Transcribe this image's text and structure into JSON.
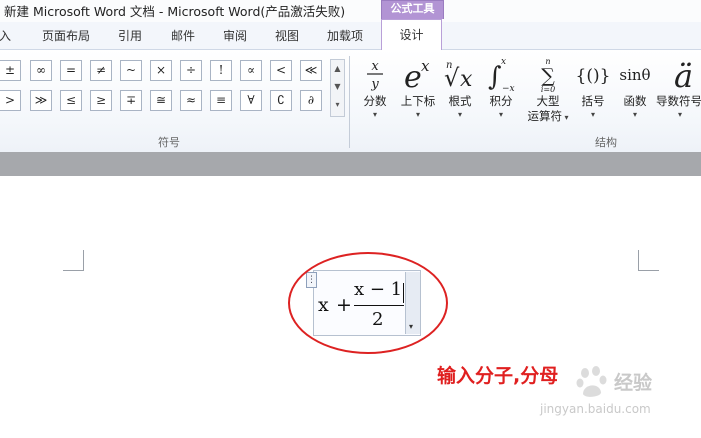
{
  "window": {
    "title": "新建 Microsoft Word 文档 - Microsoft Word(产品激活失败)",
    "context_group": "公式工具"
  },
  "tabs": [
    "入",
    "页面布局",
    "引用",
    "邮件",
    "审阅",
    "视图",
    "加载项"
  ],
  "active_tab": "设计",
  "ribbon": {
    "symbols_row1": [
      "±",
      "∞",
      "=",
      "≠",
      "~",
      "×",
      "÷",
      "!",
      "∝",
      "<",
      "≪"
    ],
    "symbols_row2": [
      ">",
      "≫",
      "≤",
      "≥",
      "∓",
      "≅",
      "≈",
      "≡",
      "∀",
      "∁",
      "∂"
    ],
    "symbols_group_label": "符号",
    "structures_group_label": "结构",
    "structures": [
      {
        "icon": "fraction-icon",
        "label": "分数"
      },
      {
        "icon": "script-icon",
        "label": "上下标"
      },
      {
        "icon": "radical-icon",
        "label": "根式"
      },
      {
        "icon": "integral-icon",
        "label": "积分"
      },
      {
        "icon": "large-operator-icon",
        "label": "大型",
        "label2": "运算符"
      },
      {
        "icon": "bracket-icon",
        "label": "括号"
      },
      {
        "icon": "function-icon",
        "label": "函数"
      },
      {
        "icon": "accent-icon",
        "label": "导数符号"
      }
    ]
  },
  "equation": {
    "x": "x",
    "plus": "+",
    "numerator": "x − 1",
    "denominator": "2"
  },
  "annotation": "输入分子,分母",
  "watermark": {
    "text": "经验",
    "url": "jingyan.baidu.com"
  },
  "colors": {
    "accent_purple": "#b294d4",
    "annotation_red": "#e02020",
    "oval_red": "#dd2222"
  }
}
